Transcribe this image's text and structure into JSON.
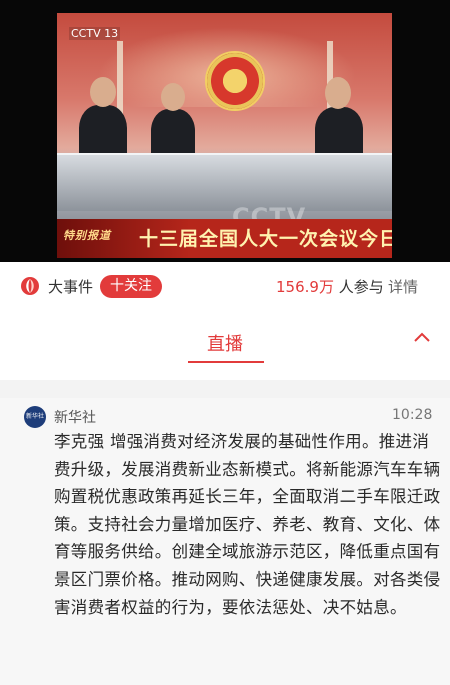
{
  "video": {
    "channel_logo": "CCTV 13",
    "ticker_tag": "特别报道",
    "ticker_text": "十三届全国人大一次会议今日开幕",
    "watermark": "CCTV"
  },
  "infobar": {
    "topic": "大事件",
    "follow_label": "十关注",
    "participants_number": "156.9万",
    "participants_suffix": "人参与",
    "detail_label": "详情"
  },
  "tabs": {
    "live_label": "直播",
    "collapse_icon": "chevron-up-icon"
  },
  "post": {
    "avatar_text": "新华社",
    "source": "新华社",
    "time": "10:28",
    "content": "李克强 增强消费对经济发展的基础性作用。推进消费升级，发展消费新业态新模式。将新能源汽车车辆购置税优惠政策再延长三年，全面取消二手车限迁政策。支持社会力量增加医疗、养老、教育、文化、体育等服务供给。创建全域旅游示范区，降低重点国有景区门票价格。推动网购、快递健康发展。对各类侵害消费者权益的行为，要依法惩处、决不姑息。"
  },
  "colors": {
    "accent": "#e23b3b",
    "ticker_red": "#b6261b"
  }
}
